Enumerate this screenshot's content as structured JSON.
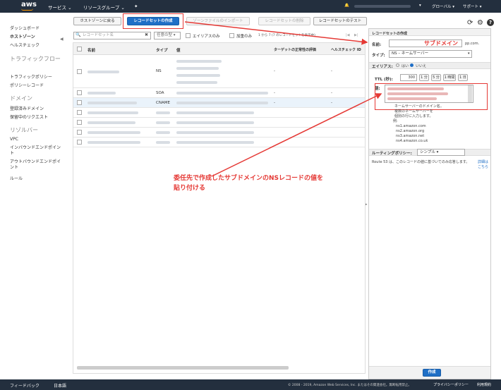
{
  "topbar": {
    "logo": "aws",
    "services": "サービス ⌄",
    "resource_groups": "リソースグループ ⌄",
    "pin": "✦",
    "bell": "🔔",
    "account": "▾",
    "region": "グローバル ▾",
    "support": "サポート ▾"
  },
  "sidebar": {
    "items": [
      "ダッシュボード",
      "ホストゾーン",
      "ヘルスチェック",
      "トラフィックフロー",
      "トラフィックポリシー",
      "ポリシーレコード",
      "ドメイン",
      "登録済みドメイン",
      "保留中のリクエスト",
      "リゾルバー",
      "VPC",
      "インバウンドエンドポイント",
      "アウトバウンドエンドポイント",
      "ルール"
    ],
    "collapse": "◀"
  },
  "toolbar": {
    "back": "ホストゾーンに戻る",
    "create": "レコードセットの作成",
    "import": "ゾーンファイルのインポート",
    "delete": "レコードセットの削除",
    "test": "レコードセットのテスト",
    "refresh": "⟳",
    "settings": "⚙",
    "help": "?"
  },
  "filter": {
    "placeholder": "レコードセット名",
    "clear": "✖",
    "type": "任意の型 ▾",
    "alias_only": "エイリアスのみ",
    "weighted_only": "加重のみ",
    "paging": "1 から 7 (7 のレコードセットを表示中)",
    "first": "|◀",
    "prev": "◀",
    "next": "▶",
    "last": "▶|"
  },
  "table": {
    "headers": [
      "名前",
      "タイプ",
      "値",
      "ターゲットの正常性の評価",
      "ヘルスチェック ID"
    ],
    "rows": [
      {
        "type": "NS",
        "eval": "-",
        "hc": "-"
      },
      {
        "type": "SOA",
        "eval": "-",
        "hc": "-"
      },
      {
        "type": "CNAME",
        "eval": "-",
        "hc": "-"
      },
      {
        "type": "",
        "eval": "",
        "hc": ""
      },
      {
        "type": "",
        "eval": "",
        "hc": ""
      },
      {
        "type": "",
        "eval": "",
        "hc": ""
      },
      {
        "type": "",
        "eval": "",
        "hc": ""
      }
    ]
  },
  "panel": {
    "title": "レコードセットの作成",
    "name_label": "名前:",
    "name_suffix": "pp.com.",
    "name_annot": "サブドメイン",
    "type_label": "タイプ:",
    "type_value": "NS – ネームサーバー",
    "alias_label": "エイリアス:",
    "alias_yes": "はい",
    "alias_no": "いいえ",
    "ttl_label": "TTL (秒):",
    "ttl_value": "300",
    "ttl_1m": "1 分",
    "ttl_5m": "5 分",
    "ttl_1h": "1 時間",
    "ttl_1d": "1 日",
    "value_label": "値:",
    "help": [
      "ネームサーバーのドメイン名。",
      "複数のネームサーバーを",
      "個別の行に入力します。",
      "例:",
      "ns1.amazon.com",
      "ns2.amazon.org",
      "ns3.amazon.net",
      "ns4.amazon.co.uk"
    ],
    "routing_label": "ルーティングポリシー:",
    "routing_value": "シンプル ▾",
    "routing_help": "Route 53 は、このレコードの値に基づいてのみ応答します。",
    "routing_more": "詳細はこちら",
    "create": "作成"
  },
  "annotation": {
    "line1": "委任先で作成したサブドメインのNSレコードの値を",
    "line2": "貼り付ける"
  },
  "footer": {
    "feedback": "フィードバック",
    "language": "日本語",
    "copyright": "© 2008 - 2019, Amazon Web Services, Inc. またはその関連会社。無断転用禁止。",
    "privacy": "プライバシーポリシー",
    "terms": "利用規約"
  }
}
